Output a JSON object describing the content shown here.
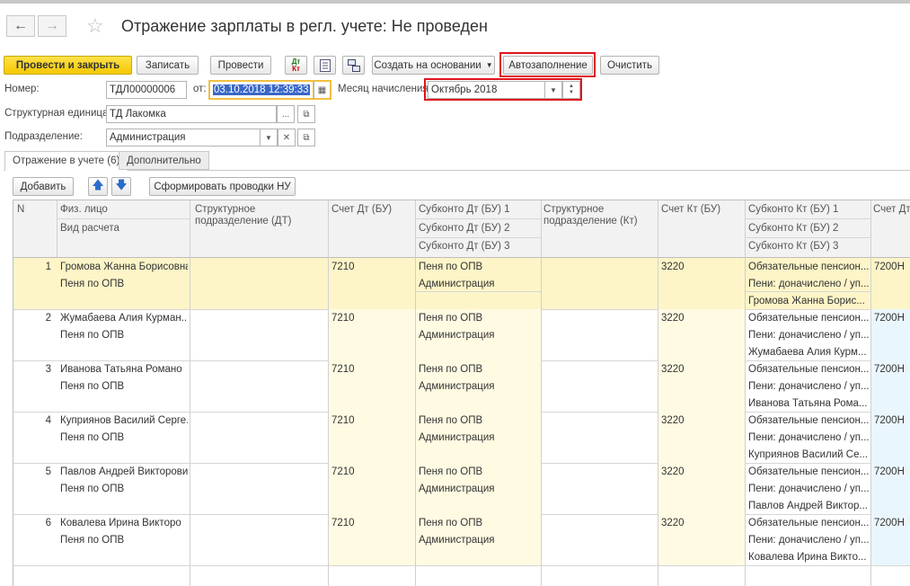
{
  "window": {
    "title": "Отражение зарплаты в регл. учете: Не проведен"
  },
  "nav": {
    "back_icon": "←",
    "forward_icon": "→",
    "star_icon": "☆"
  },
  "toolbar": {
    "post_close": "Провести и закрыть",
    "save": "Записать",
    "post": "Провести",
    "dtkt_icon_top": "Дт",
    "dtkt_icon_bottom": "Кт",
    "create_based": "Создать на основании",
    "autofill": "Автозаполнение",
    "clear": "Очистить"
  },
  "form": {
    "number_label": "Номер:",
    "number_value": "ТДЛ00000006",
    "from_label": "от:",
    "date_value": "03.10.2018 12:39:33",
    "month_label": "Месяц начисления",
    "month_value": "Октябрь 2018",
    "org_label": "Структурная единица:",
    "org_value": "ТД Лакомка",
    "dept_label": "Подразделение:",
    "dept_value": "Администрация"
  },
  "tabs": [
    {
      "label": "Отражение в учете (6)",
      "active": true
    },
    {
      "label": "Дополнительно",
      "active": false
    }
  ],
  "table_toolbar": {
    "add": "Добавить",
    "generate": "Сформировать проводки НУ"
  },
  "columns": {
    "n": "N",
    "person": "Физ. лицо",
    "calc_type": "Вид расчета",
    "dept_dt_1": "Структурное",
    "dept_dt_2": "подразделение (ДТ)",
    "acc_dt": "Счет Дт (БУ)",
    "sub_dt_1": "Субконто Дт (БУ) 1",
    "sub_dt_2": "Субконто Дт (БУ) 2",
    "sub_dt_3": "Субконто Дт (БУ) 3",
    "dept_kt_1": "Структурное",
    "dept_kt_2": "подразделение (Кт)",
    "acc_kt": "Счет Кт (БУ)",
    "sub_kt_1": "Субконто Кт (БУ) 1",
    "sub_kt_2": "Субконто Кт (БУ) 2",
    "sub_kt_3": "Субконто Кт (БУ) 3",
    "acc_dt_nu": "Счет Дт"
  },
  "rows": [
    {
      "n": "1",
      "person": "Громова Жанна Борисовна",
      "calc": "Пеня по ОПВ",
      "acc_dt": "7210",
      "sub_dt_1": "Пеня по ОПВ",
      "sub_dt_2": "Администрация",
      "acc_kt": "3220",
      "sub_kt_1": "Обязательные пенсион...",
      "sub_kt_2": "Пени: доначислено / уп...",
      "sub_kt_3": "Громова Жанна Борис...",
      "acc_nu": "7200Н"
    },
    {
      "n": "2",
      "person": "Жумабаева Алия Курман...",
      "calc": "Пеня по ОПВ",
      "acc_dt": "7210",
      "sub_dt_1": "Пеня по ОПВ",
      "sub_dt_2": "Администрация",
      "acc_kt": "3220",
      "sub_kt_1": "Обязательные пенсион...",
      "sub_kt_2": "Пени: доначислено / уп...",
      "sub_kt_3": "Жумабаева Алия Курм...",
      "acc_nu": "7200Н"
    },
    {
      "n": "3",
      "person": "Иванова Татьяна Романо",
      "calc": "Пеня по ОПВ",
      "acc_dt": "7210",
      "sub_dt_1": "Пеня по ОПВ",
      "sub_dt_2": "Администрация",
      "acc_kt": "3220",
      "sub_kt_1": "Обязательные пенсион...",
      "sub_kt_2": "Пени: доначислено / уп...",
      "sub_kt_3": "Иванова Татьяна Рома...",
      "acc_nu": "7200Н"
    },
    {
      "n": "4",
      "person": "Куприянов Василий Серге...",
      "calc": "Пеня по ОПВ",
      "acc_dt": "7210",
      "sub_dt_1": "Пеня по ОПВ",
      "sub_dt_2": "Администрация",
      "acc_kt": "3220",
      "sub_kt_1": "Обязательные пенсион...",
      "sub_kt_2": "Пени: доначислено / уп...",
      "sub_kt_3": "Куприянов Василий Се...",
      "acc_nu": "7200Н"
    },
    {
      "n": "5",
      "person": "Павлов Андрей Викторович",
      "calc": "Пеня по ОПВ",
      "acc_dt": "7210",
      "sub_dt_1": "Пеня по ОПВ",
      "sub_dt_2": "Администрация",
      "acc_kt": "3220",
      "sub_kt_1": "Обязательные пенсион...",
      "sub_kt_2": "Пени: доначислено / уп...",
      "sub_kt_3": "Павлов Андрей Виктор...",
      "acc_nu": "7200Н"
    },
    {
      "n": "6",
      "person": "Ковалева Ирина Викторо",
      "calc": "Пеня по ОПВ",
      "acc_dt": "7210",
      "sub_dt_1": "Пеня по ОПВ",
      "sub_dt_2": "Администрация",
      "acc_kt": "3220",
      "sub_kt_1": "Обязательные пенсион...",
      "sub_kt_2": "Пени: доначислено / уп...",
      "sub_kt_3": "Ковалева Ирина Викто...",
      "acc_nu": "7200Н"
    }
  ],
  "colors": {
    "accent_yellow": "#f5c800",
    "highlight_red": "#e0141e",
    "selected_row": "#fdf5c8",
    "cell_yellow": "#fffbe3",
    "cell_blue": "#eaf6fd"
  }
}
